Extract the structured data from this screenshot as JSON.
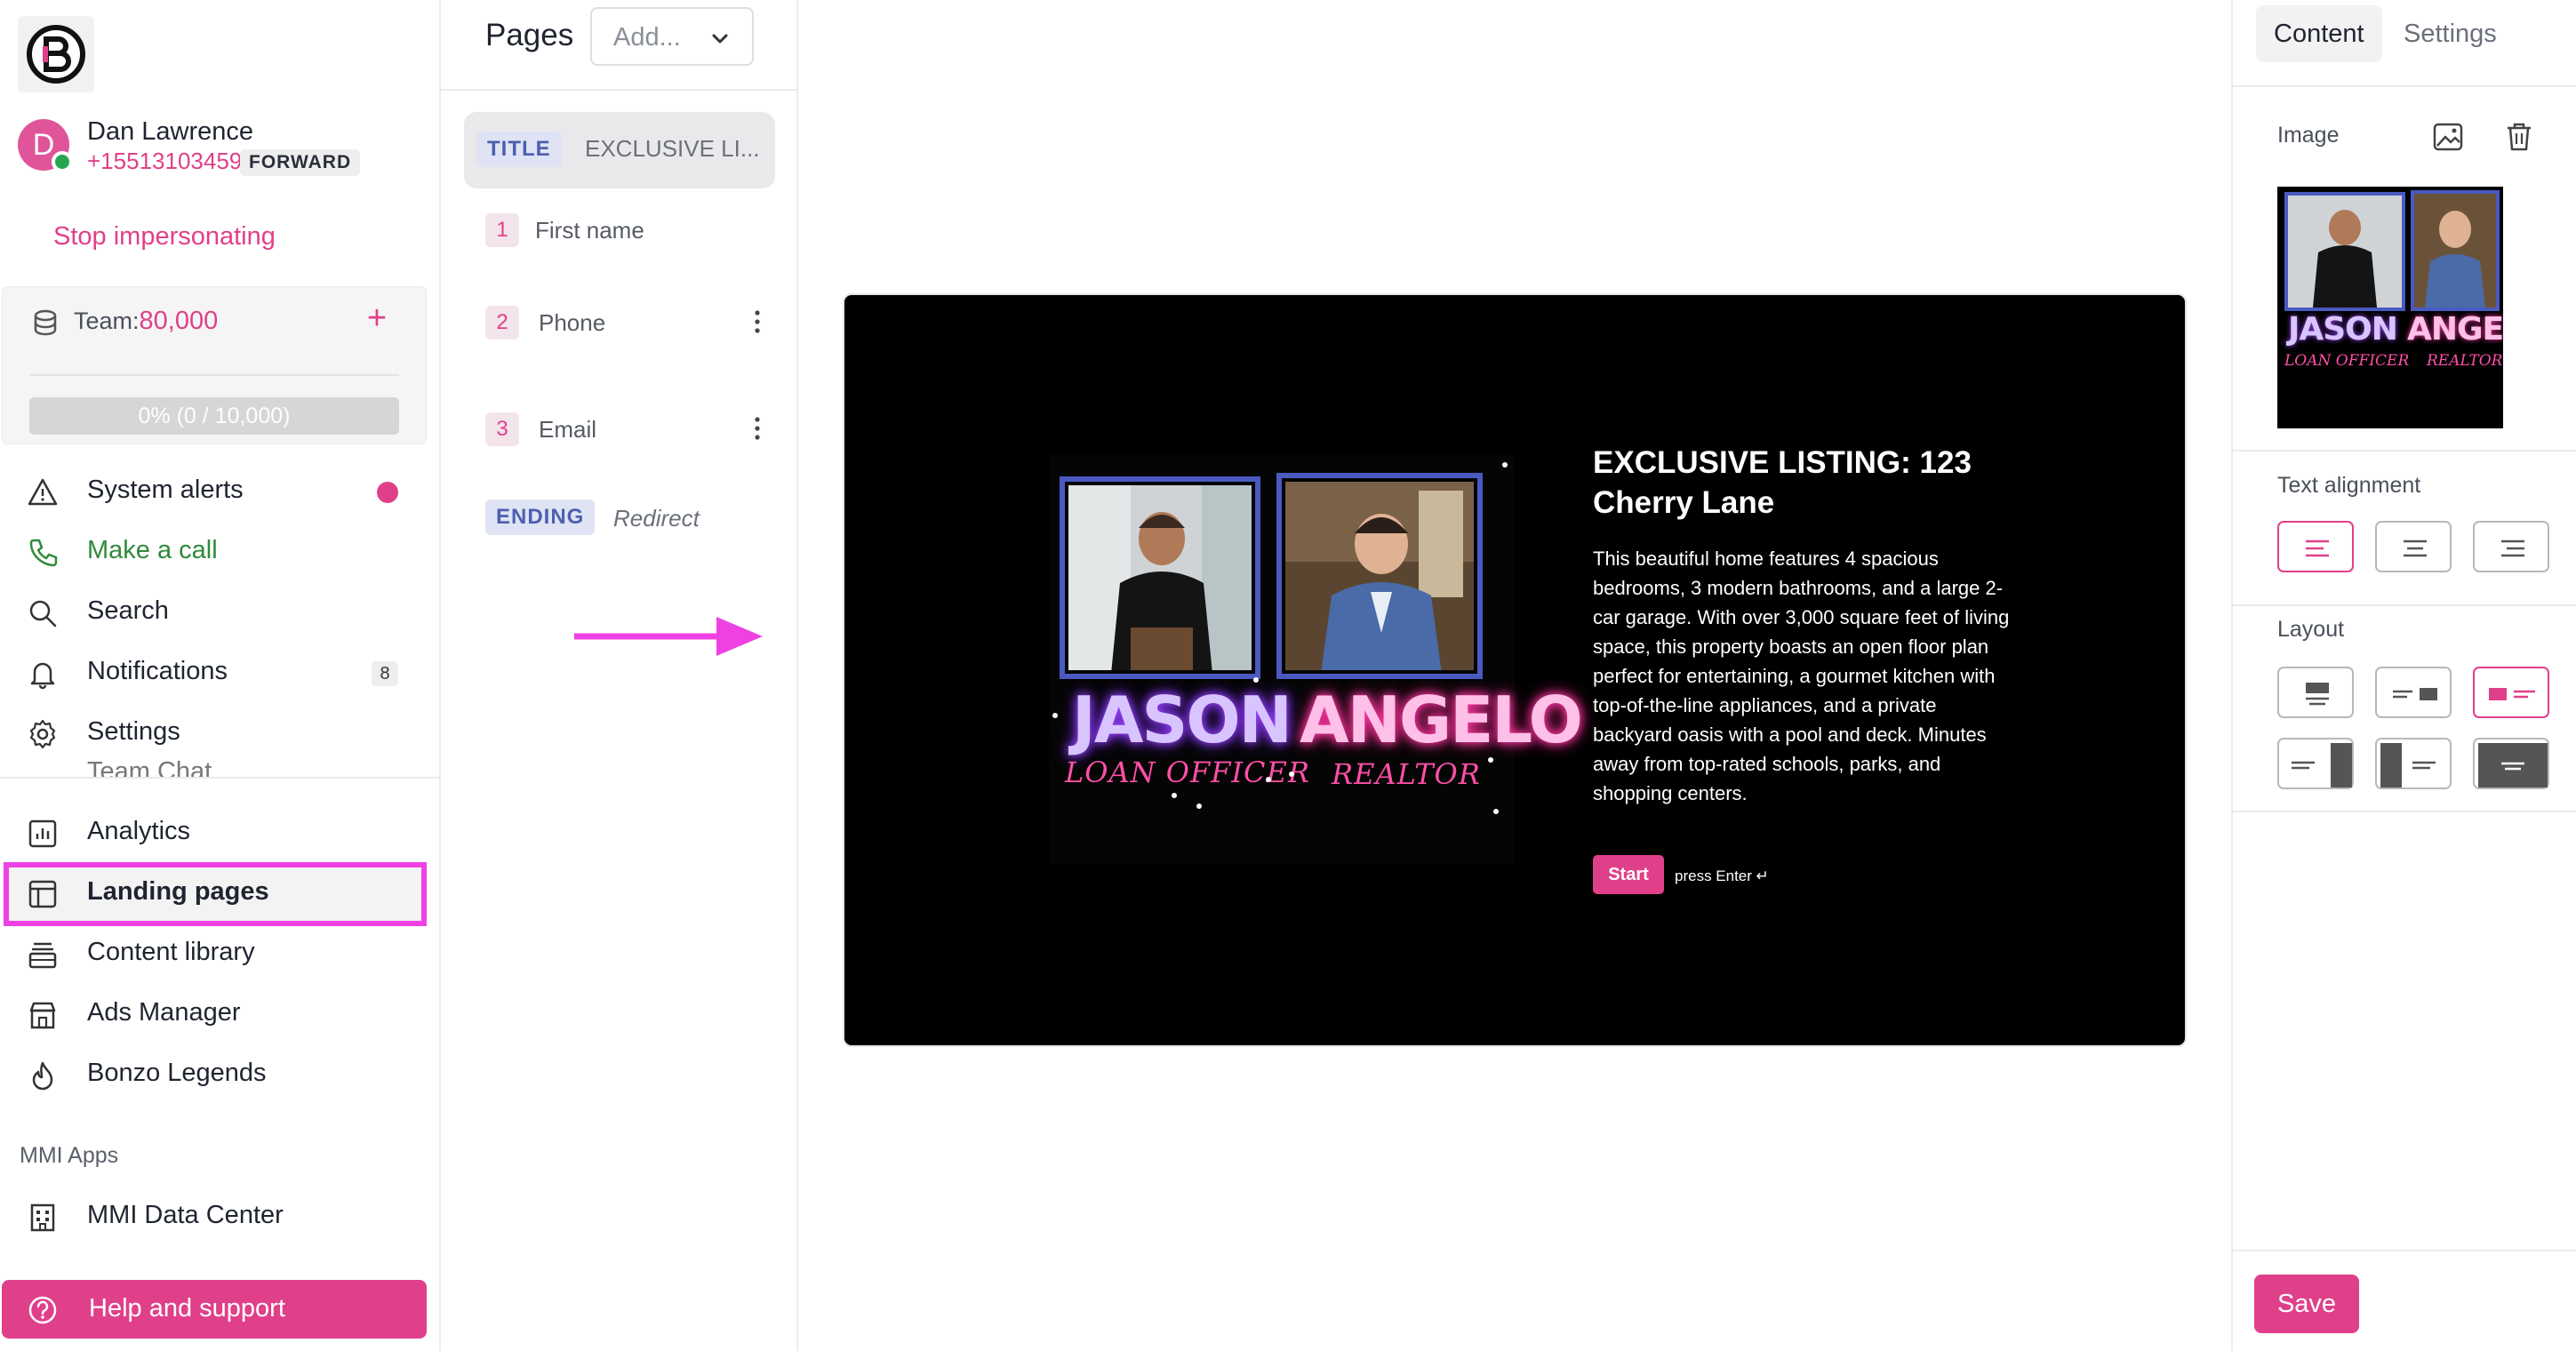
{
  "user": {
    "initial": "D",
    "name": "Dan Lawrence",
    "phone": "+15513103459",
    "badge": "FORWARD"
  },
  "sidebar": {
    "stop_impersonating": "Stop impersonating",
    "team_label": "Team:",
    "team_credits": "80,000",
    "progress_text": "0% (0 / 10,000)",
    "progress_fraction": 0,
    "ghost_item": "Team Chat",
    "items": [
      {
        "label": "System alerts",
        "icon": "warning-icon"
      },
      {
        "label": "Make a call",
        "icon": "phone-icon"
      },
      {
        "label": "Search",
        "icon": "search-icon"
      },
      {
        "label": "Notifications",
        "icon": "bell-icon",
        "count": "8"
      },
      {
        "label": "Settings",
        "icon": "gear-icon"
      },
      {
        "label": "Analytics",
        "icon": "chart-icon"
      },
      {
        "label": "Landing pages",
        "icon": "layout-icon"
      },
      {
        "label": "Content library",
        "icon": "stack-icon"
      },
      {
        "label": "Ads Manager",
        "icon": "store-icon"
      },
      {
        "label": "Bonzo Legends",
        "icon": "flame-icon"
      }
    ],
    "section_label": "MMI Apps",
    "mmi_item": {
      "label": "MMI Data Center",
      "icon": "building-icon"
    },
    "help": "Help and support"
  },
  "pages": {
    "title": "Pages",
    "add_placeholder": "Add...",
    "title_tag": "TITLE",
    "title_desc": "EXCLUSIVE LI...",
    "questions": [
      {
        "num": "1",
        "label": "First name"
      },
      {
        "num": "2",
        "label": "Phone"
      },
      {
        "num": "3",
        "label": "Email"
      }
    ],
    "ending_tag": "ENDING",
    "ending_label": "Redirect"
  },
  "preview": {
    "poster_name_left": "JASON",
    "poster_role_left": "LOAN OFFICER",
    "poster_name_right": "ANGELO",
    "poster_role_right": "REALTOR",
    "title": "EXCLUSIVE LISTING:  123 Cherry Lane",
    "description": "This beautiful home features 4 spacious bedrooms, 3 modern bathrooms, and a large 2-car garage. With over 3,000 square feet of living space, this property boasts an open floor plan perfect for entertaining, a gourmet kitchen with top-of-the-line appliances, and a private backyard oasis with a pool and deck. Minutes away from top-rated schools, parks, and shopping centers.",
    "start_button": "Start",
    "press_enter": "press Enter ↵"
  },
  "right_panel": {
    "tabs": [
      "Content",
      "Settings"
    ],
    "image_label": "Image",
    "text_alignment_label": "Text alignment",
    "layout_label": "Layout",
    "selected_alignment": "left",
    "save": "Save"
  },
  "colors": {
    "accent": "#e0408a",
    "highlight_box": "#ef41e3",
    "tag_blue": "#4c5fb0",
    "green": "#2f8a3a"
  }
}
